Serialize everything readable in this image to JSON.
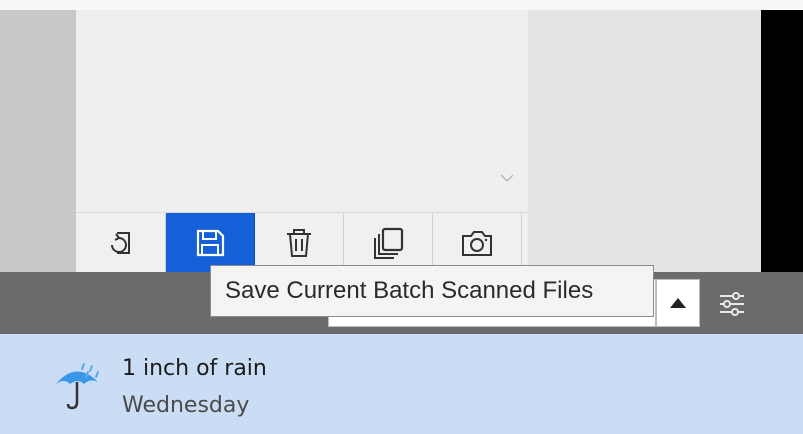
{
  "toolbar": {
    "buttons": [
      {
        "icon": "rotate-export-icon",
        "active": false
      },
      {
        "icon": "save-icon",
        "active": true
      },
      {
        "icon": "trash-icon",
        "active": false
      },
      {
        "icon": "copy-pages-icon",
        "active": false
      },
      {
        "icon": "camera-icon",
        "active": false
      }
    ]
  },
  "tooltip": {
    "text": "Save Current Batch Scanned Files"
  },
  "tray": {
    "up_icon": "triangle-up-icon",
    "settings_icon": "sliders-icon"
  },
  "weather": {
    "line1": "1 inch of rain",
    "line2": "Wednesday",
    "icon": "umbrella-rain-icon"
  },
  "colors": {
    "active_button": "#1360d8",
    "taskbar": "#6b6b6b",
    "weather_bg": "#cbdcf5"
  }
}
